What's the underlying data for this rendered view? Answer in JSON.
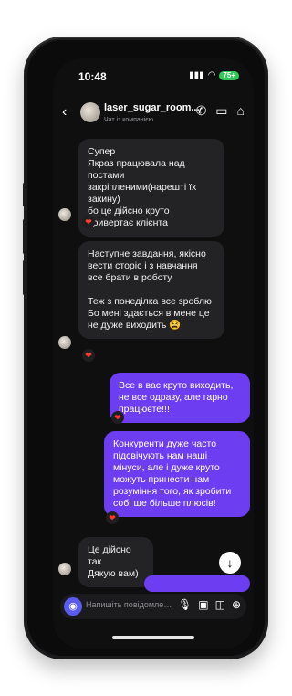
{
  "status": {
    "time": "10:48",
    "battery": "75+"
  },
  "header": {
    "title": "laser_sugar_room...",
    "subtitle": "Чат із компанією"
  },
  "messages": [
    {
      "side": "in",
      "text": "Супер\nЯкраз працювала над постами закріпленими(нарешті їх закину)\nбо це дійсно круто привертає клієнта",
      "reaction": "❤"
    },
    {
      "side": "in",
      "text": "Наступне завдання, якісно вести сторіс і з навчання все брати в роботу\n\nТеж з понеділка все зроблю\nБо мені здається в мене це не дуже виходить 😫",
      "reaction": "❤"
    },
    {
      "side": "out",
      "text": "Все в вас круто виходить, не все одразу, але гарно працюєте!!!",
      "reaction": "❤"
    },
    {
      "side": "out",
      "text": "Конкуренти дуже часто підсвічують нам наші мінуси, але і дуже круто можуть принести нам розуміння того, як зробити собі ще більше плюсів!",
      "reaction": "❤"
    },
    {
      "side": "in",
      "text": "Це дійсно так\nДякую вам)",
      "reaction": ""
    }
  ],
  "composer": {
    "placeholder": "Напишіть повідомлення..."
  },
  "colors": {
    "outgoing": "#6d3df2",
    "incoming": "#232325",
    "background": "#0f0f10"
  }
}
